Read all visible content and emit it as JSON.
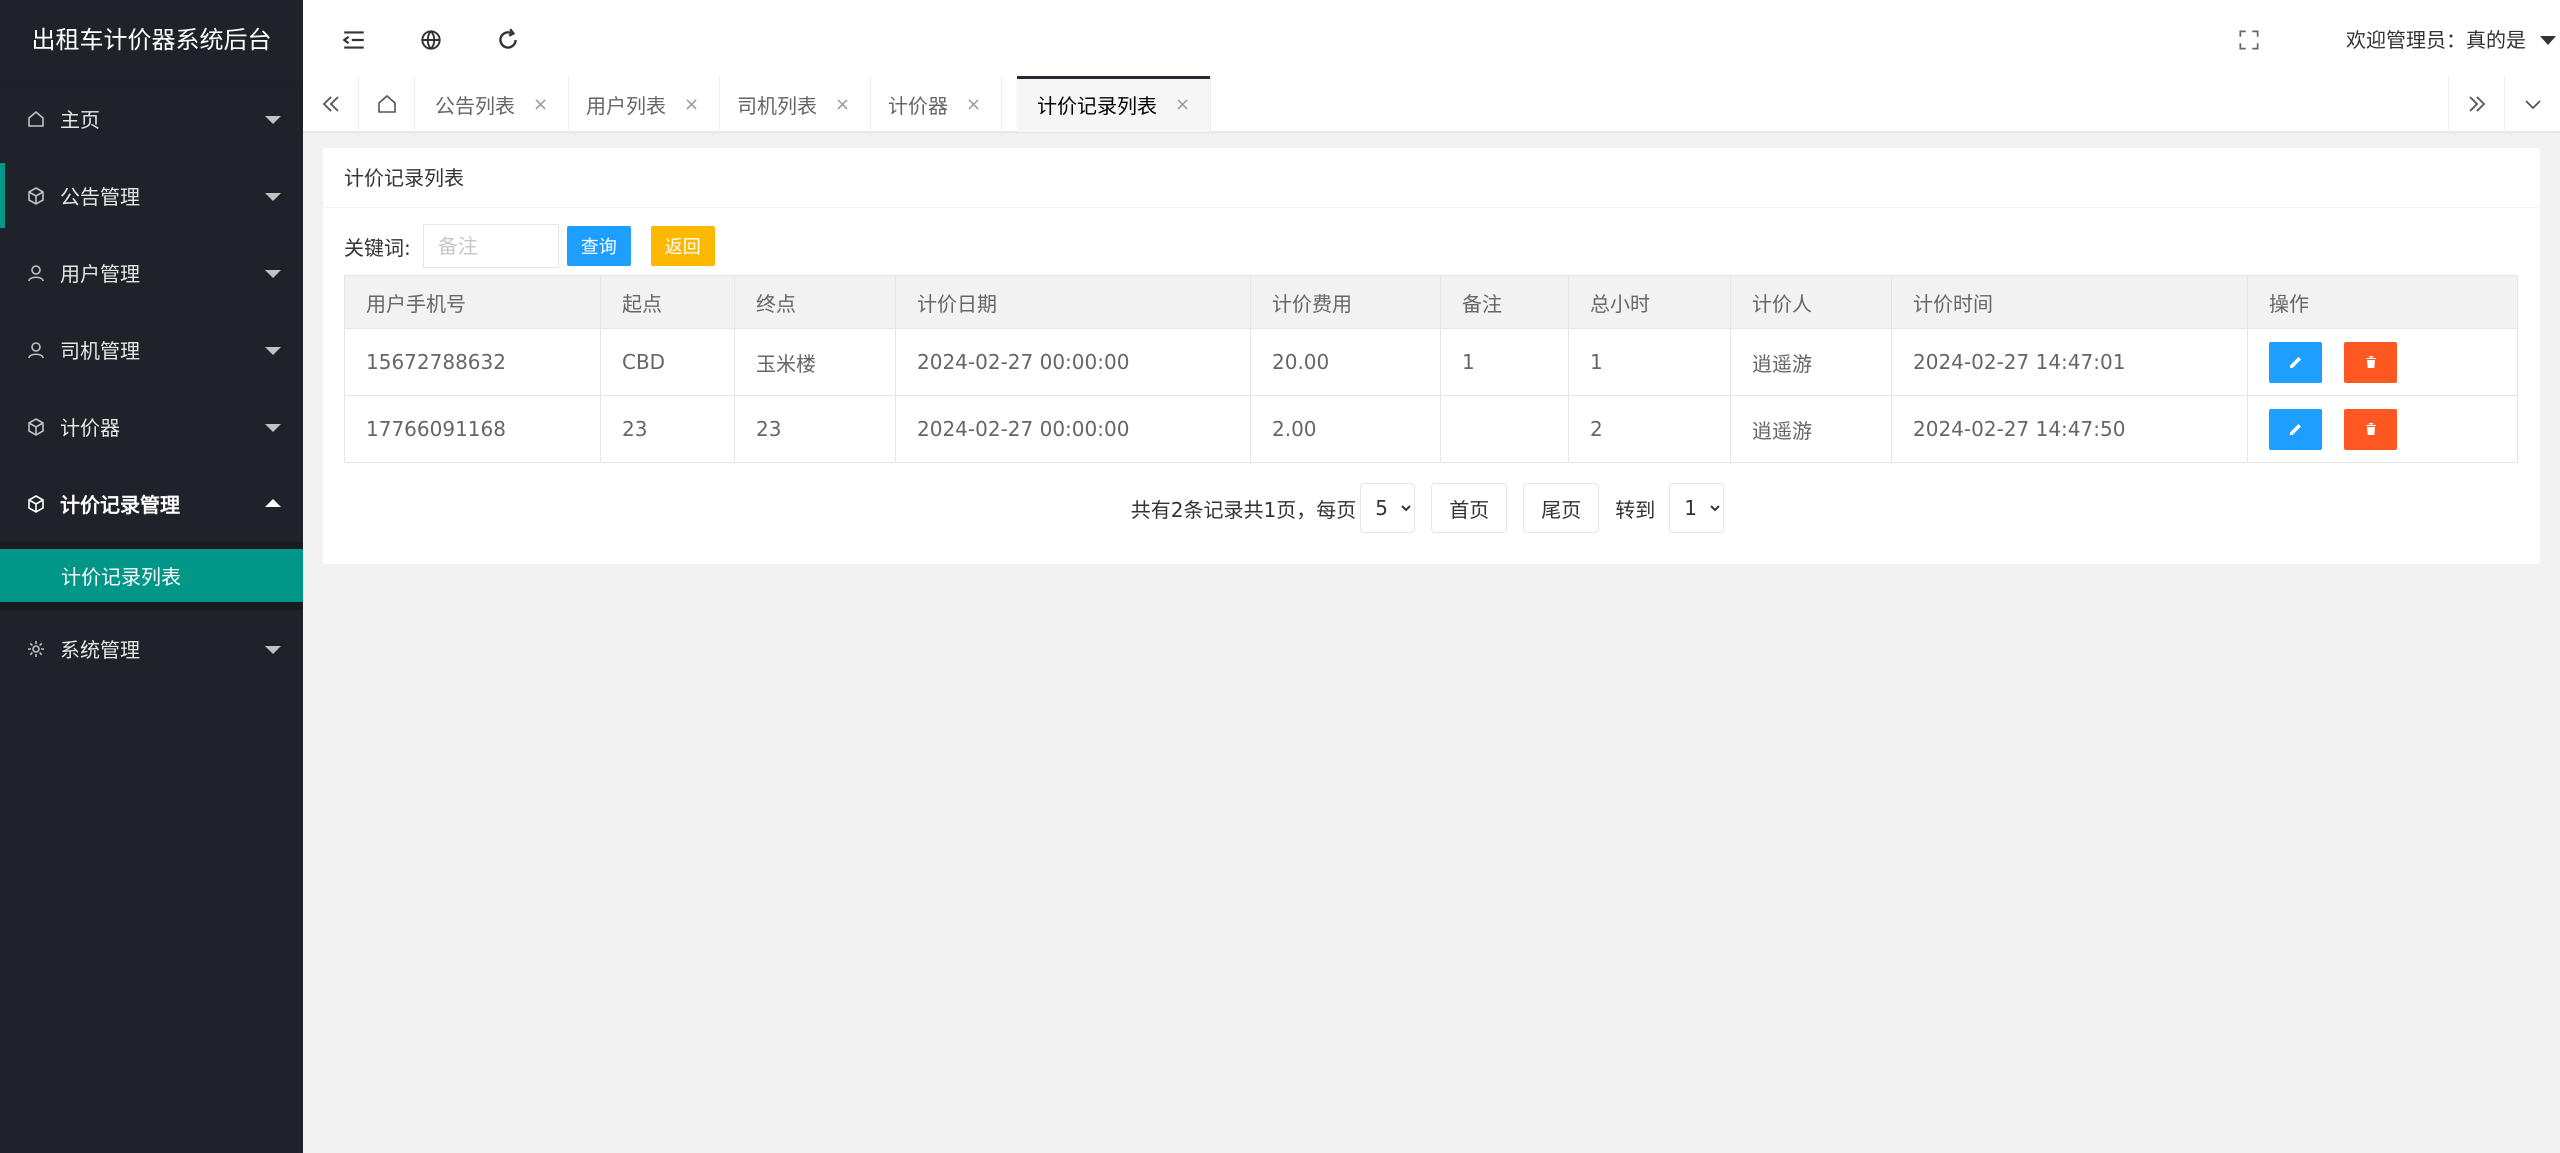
{
  "app": {
    "title": "出租车计价器系统后台"
  },
  "sidebar": {
    "items": [
      {
        "label": "主页",
        "icon": "home-icon"
      },
      {
        "label": "公告管理",
        "icon": "cube-icon"
      },
      {
        "label": "用户管理",
        "icon": "user-icon"
      },
      {
        "label": "司机管理",
        "icon": "user-icon"
      },
      {
        "label": "计价器",
        "icon": "cube-icon"
      },
      {
        "label": "计价记录管理",
        "icon": "cube-icon",
        "submenu": [
          {
            "label": "计价记录列表"
          }
        ]
      },
      {
        "label": "系统管理",
        "icon": "gear-icon"
      }
    ]
  },
  "header": {
    "welcome": "欢迎管理员：真的是"
  },
  "tabs": [
    {
      "label": "公告列表"
    },
    {
      "label": "用户列表"
    },
    {
      "label": "司机列表"
    },
    {
      "label": "计价器"
    },
    {
      "label": "计价记录列表"
    }
  ],
  "tab_close": "×",
  "card": {
    "title": "计价记录列表",
    "search": {
      "label": "关键词:",
      "placeholder": "备注",
      "query_label": "查询",
      "back_label": "返回"
    }
  },
  "table": {
    "columns": [
      "用户手机号",
      "起点",
      "终点",
      "计价日期",
      "计价费用",
      "备注",
      "总小时",
      "计价人",
      "计价时间",
      "操作"
    ],
    "rows": [
      {
        "phone": "15672788632",
        "start": "CBD",
        "end": "玉米楼",
        "date": "2024-02-27 00:00:00",
        "fee": "20.00",
        "note": "1",
        "hours": "1",
        "person": "逍遥游",
        "time": "2024-02-27 14:47:01"
      },
      {
        "phone": "17766091168",
        "start": "23",
        "end": "23",
        "date": "2024-02-27 00:00:00",
        "fee": "2.00",
        "note": "",
        "hours": "2",
        "person": "逍遥游",
        "time": "2024-02-27 14:47:50"
      }
    ]
  },
  "pager": {
    "summary": "共有2条记录共1页，每页",
    "page_size": "5",
    "first_label": "首页",
    "last_label": "尾页",
    "goto_label": "转到",
    "goto_page": "1"
  },
  "colors": {
    "sidebar_bg": "#20222a",
    "accent": "#009688",
    "blue": "#1e9fff",
    "yellow": "#ffb800",
    "red": "#ff5722"
  }
}
